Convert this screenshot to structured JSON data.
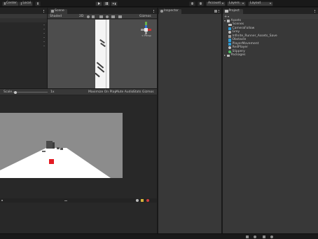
{
  "toolbar": {
    "pivot_label": "Center",
    "space_label": "Local",
    "account_label": "Account",
    "layers_label": "Layers",
    "layout_label": "Layout"
  },
  "scene_view": {
    "tab_label": "Scene",
    "shading_label": "Shaded",
    "mode_2d": "2D",
    "gizmos_label": "Gizmos",
    "persp_label": "< Persp"
  },
  "game_view": {
    "scale_label": "Scale",
    "scale_value": "1x",
    "maximize_label": "Maximize On Play",
    "mute_label": "Mute Audio",
    "stats_label": "Stats",
    "gizmos_label": "Gizmos"
  },
  "inspector": {
    "tab_label": "Inspector"
  },
  "project": {
    "tab_label": "Project",
    "create_label": "+",
    "root_label": "Assets",
    "items": [
      {
        "label": "Scenes",
        "icon": "folder-icon"
      },
      {
        "label": "CameraFollow",
        "icon": "cs-script-icon"
      },
      {
        "label": "Grey",
        "icon": "material-icon"
      },
      {
        "label": "Infinite_Runner_Assets_Save",
        "icon": "scene-file-icon"
      },
      {
        "label": "Obstacle",
        "icon": "cs-script-icon"
      },
      {
        "label": "PlayerMovement",
        "icon": "cs-script-icon"
      },
      {
        "label": "RedPlayer",
        "icon": "material-icon"
      },
      {
        "label": "Slippery",
        "icon": "physics-material-icon"
      }
    ],
    "packages_label": "Packages"
  },
  "status_bar": {
    "icons": [
      "console-icon",
      "bug-icon",
      "collab-icon",
      "settings-icon"
    ]
  },
  "colors": {
    "accent_play": "#d4d4d4",
    "panel": "#383838",
    "dark_panel": "#282828",
    "cs_icon": "#2f9cd6",
    "player_red": "#e31b23"
  }
}
